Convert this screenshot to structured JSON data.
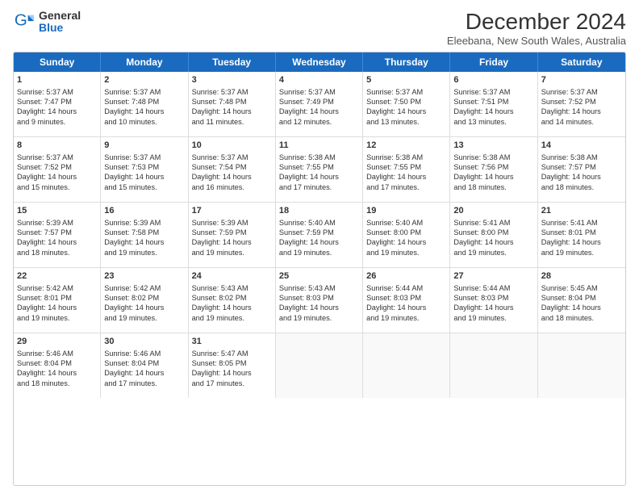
{
  "logo": {
    "general": "General",
    "blue": "Blue"
  },
  "title": "December 2024",
  "subtitle": "Eleebana, New South Wales, Australia",
  "days": [
    "Sunday",
    "Monday",
    "Tuesday",
    "Wednesday",
    "Thursday",
    "Friday",
    "Saturday"
  ],
  "weeks": [
    [
      {
        "day": "1",
        "sunrise": "5:37 AM",
        "sunset": "7:47 PM",
        "daylight": "14 hours and 9 minutes."
      },
      {
        "day": "2",
        "sunrise": "5:37 AM",
        "sunset": "7:48 PM",
        "daylight": "14 hours and 10 minutes."
      },
      {
        "day": "3",
        "sunrise": "5:37 AM",
        "sunset": "7:48 PM",
        "daylight": "14 hours and 11 minutes."
      },
      {
        "day": "4",
        "sunrise": "5:37 AM",
        "sunset": "7:49 PM",
        "daylight": "14 hours and 12 minutes."
      },
      {
        "day": "5",
        "sunrise": "5:37 AM",
        "sunset": "7:50 PM",
        "daylight": "14 hours and 13 minutes."
      },
      {
        "day": "6",
        "sunrise": "5:37 AM",
        "sunset": "7:51 PM",
        "daylight": "14 hours and 13 minutes."
      },
      {
        "day": "7",
        "sunrise": "5:37 AM",
        "sunset": "7:52 PM",
        "daylight": "14 hours and 14 minutes."
      }
    ],
    [
      {
        "day": "8",
        "sunrise": "5:37 AM",
        "sunset": "7:52 PM",
        "daylight": "14 hours and 15 minutes."
      },
      {
        "day": "9",
        "sunrise": "5:37 AM",
        "sunset": "7:53 PM",
        "daylight": "14 hours and 15 minutes."
      },
      {
        "day": "10",
        "sunrise": "5:37 AM",
        "sunset": "7:54 PM",
        "daylight": "14 hours and 16 minutes."
      },
      {
        "day": "11",
        "sunrise": "5:38 AM",
        "sunset": "7:55 PM",
        "daylight": "14 hours and 17 minutes."
      },
      {
        "day": "12",
        "sunrise": "5:38 AM",
        "sunset": "7:55 PM",
        "daylight": "14 hours and 17 minutes."
      },
      {
        "day": "13",
        "sunrise": "5:38 AM",
        "sunset": "7:56 PM",
        "daylight": "14 hours and 18 minutes."
      },
      {
        "day": "14",
        "sunrise": "5:38 AM",
        "sunset": "7:57 PM",
        "daylight": "14 hours and 18 minutes."
      }
    ],
    [
      {
        "day": "15",
        "sunrise": "5:39 AM",
        "sunset": "7:57 PM",
        "daylight": "14 hours and 18 minutes."
      },
      {
        "day": "16",
        "sunrise": "5:39 AM",
        "sunset": "7:58 PM",
        "daylight": "14 hours and 19 minutes."
      },
      {
        "day": "17",
        "sunrise": "5:39 AM",
        "sunset": "7:59 PM",
        "daylight": "14 hours and 19 minutes."
      },
      {
        "day": "18",
        "sunrise": "5:40 AM",
        "sunset": "7:59 PM",
        "daylight": "14 hours and 19 minutes."
      },
      {
        "day": "19",
        "sunrise": "5:40 AM",
        "sunset": "8:00 PM",
        "daylight": "14 hours and 19 minutes."
      },
      {
        "day": "20",
        "sunrise": "5:41 AM",
        "sunset": "8:00 PM",
        "daylight": "14 hours and 19 minutes."
      },
      {
        "day": "21",
        "sunrise": "5:41 AM",
        "sunset": "8:01 PM",
        "daylight": "14 hours and 19 minutes."
      }
    ],
    [
      {
        "day": "22",
        "sunrise": "5:42 AM",
        "sunset": "8:01 PM",
        "daylight": "14 hours and 19 minutes."
      },
      {
        "day": "23",
        "sunrise": "5:42 AM",
        "sunset": "8:02 PM",
        "daylight": "14 hours and 19 minutes."
      },
      {
        "day": "24",
        "sunrise": "5:43 AM",
        "sunset": "8:02 PM",
        "daylight": "14 hours and 19 minutes."
      },
      {
        "day": "25",
        "sunrise": "5:43 AM",
        "sunset": "8:03 PM",
        "daylight": "14 hours and 19 minutes."
      },
      {
        "day": "26",
        "sunrise": "5:44 AM",
        "sunset": "8:03 PM",
        "daylight": "14 hours and 19 minutes."
      },
      {
        "day": "27",
        "sunrise": "5:44 AM",
        "sunset": "8:03 PM",
        "daylight": "14 hours and 19 minutes."
      },
      {
        "day": "28",
        "sunrise": "5:45 AM",
        "sunset": "8:04 PM",
        "daylight": "14 hours and 18 minutes."
      }
    ],
    [
      {
        "day": "29",
        "sunrise": "5:46 AM",
        "sunset": "8:04 PM",
        "daylight": "14 hours and 18 minutes."
      },
      {
        "day": "30",
        "sunrise": "5:46 AM",
        "sunset": "8:04 PM",
        "daylight": "14 hours and 17 minutes."
      },
      {
        "day": "31",
        "sunrise": "5:47 AM",
        "sunset": "8:05 PM",
        "daylight": "14 hours and 17 minutes."
      },
      null,
      null,
      null,
      null
    ]
  ],
  "labels": {
    "sunrise": "Sunrise:",
    "sunset": "Sunset:",
    "daylight": "Daylight:"
  }
}
